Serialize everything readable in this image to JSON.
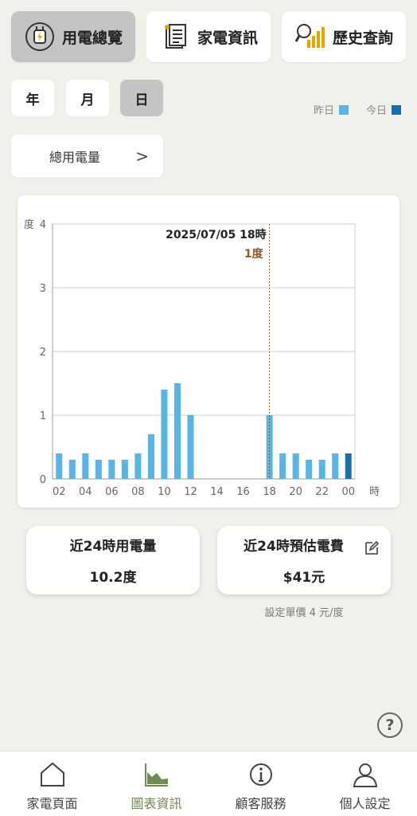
{
  "top_tabs": [
    {
      "label": "用電總覽",
      "active": true
    },
    {
      "label": "家電資訊",
      "active": false
    },
    {
      "label": "歷史查詢",
      "active": false
    }
  ],
  "period_tabs": [
    {
      "label": "年",
      "active": false
    },
    {
      "label": "月",
      "active": false
    },
    {
      "label": "日",
      "active": true
    }
  ],
  "legend": {
    "yesterday_label": "昨日",
    "yesterday_color": "#5ab4e5",
    "today_label": "今日",
    "today_color": "#1a6fa8"
  },
  "metric_select": {
    "label": "總用電量",
    "chevron": ">"
  },
  "chart_data": {
    "type": "bar",
    "ylabel": "度",
    "xlabel": "時",
    "ylim": [
      0,
      4
    ],
    "y_ticks": [
      "0",
      "1",
      "2",
      "3",
      "4"
    ],
    "x_tick_labels": [
      "02",
      "04",
      "06",
      "08",
      "10",
      "12",
      "14",
      "16",
      "18",
      "20",
      "22",
      "00"
    ],
    "categories": [
      "02",
      "03",
      "04",
      "05",
      "06",
      "07",
      "08",
      "09",
      "10",
      "11",
      "12",
      "13",
      "14",
      "15",
      "16",
      "17",
      "18",
      "19",
      "20",
      "21",
      "22",
      "23",
      "00"
    ],
    "series": [
      {
        "name": "昨日",
        "color": "#5ab4e5",
        "values": [
          0.4,
          0.3,
          0.4,
          0.3,
          0.3,
          0.3,
          0.4,
          0.7,
          1.4,
          1.5,
          1.0,
          0,
          0,
          0,
          0,
          0,
          1.0,
          0.4,
          0.4,
          0.3,
          0.3,
          0.4,
          null
        ]
      },
      {
        "name": "今日",
        "color": "#1a6fa8",
        "values": [
          null,
          null,
          null,
          null,
          null,
          null,
          null,
          null,
          null,
          null,
          null,
          null,
          null,
          null,
          null,
          null,
          null,
          null,
          null,
          null,
          null,
          null,
          0.4
        ]
      }
    ],
    "grid": true,
    "selected_index": 16,
    "tooltip": {
      "date": "2025/07/05 18時",
      "value": "1度"
    }
  },
  "stats": {
    "usage_label": "近24時用電量",
    "usage_value": "10.2度",
    "cost_label": "近24時預估電費",
    "cost_value": "$41元",
    "price_note": "設定單價 4 元/度"
  },
  "help_icon": "?",
  "bottom_nav": [
    {
      "label": "家電頁面",
      "icon": "house-icon",
      "active": false
    },
    {
      "label": "圖表資訊",
      "icon": "area-chart-icon",
      "active": true
    },
    {
      "label": "顧客服務",
      "icon": "info-icon",
      "active": false
    },
    {
      "label": "個人設定",
      "icon": "person-icon",
      "active": false
    }
  ]
}
